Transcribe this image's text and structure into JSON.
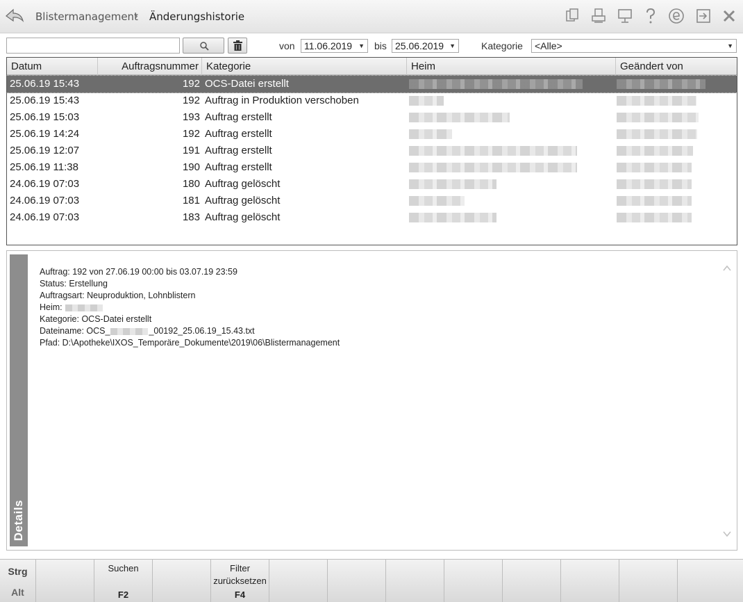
{
  "header": {
    "breadcrumb_root": "Blistermanagement",
    "breadcrumb_sep": "›",
    "breadcrumb_current": "Änderungshistorie",
    "icons": [
      "copy-icon",
      "print-icon",
      "monitor-icon",
      "help-icon",
      "e-icon",
      "exit-window-icon",
      "close-icon"
    ]
  },
  "filter": {
    "search_value": "",
    "von_label": "von",
    "von_value": "11.06.2019",
    "bis_label": "bis",
    "bis_value": "25.06.2019",
    "kategorie_label": "Kategorie",
    "kategorie_value": "<Alle>"
  },
  "table": {
    "columns": [
      "Datum",
      "Auftragsnummer",
      "Kategorie",
      "Heim",
      "Geändert von"
    ],
    "rows": [
      {
        "datum": "25.06.19 15:43",
        "nr": "192",
        "kategorie": "OCS-Datei erstellt"
      },
      {
        "datum": "25.06.19 15:43",
        "nr": "192",
        "kategorie": "Auftrag in Produktion verschoben"
      },
      {
        "datum": "25.06.19 15:03",
        "nr": "193",
        "kategorie": "Auftrag erstellt"
      },
      {
        "datum": "25.06.19 14:24",
        "nr": "192",
        "kategorie": "Auftrag erstellt"
      },
      {
        "datum": "25.06.19 12:07",
        "nr": "191",
        "kategorie": "Auftrag erstellt"
      },
      {
        "datum": "25.06.19 11:38",
        "nr": "190",
        "kategorie": "Auftrag erstellt"
      },
      {
        "datum": "24.06.19 07:03",
        "nr": "180",
        "kategorie": "Auftrag gelöscht"
      },
      {
        "datum": "24.06.19 07:03",
        "nr": "181",
        "kategorie": "Auftrag gelöscht"
      },
      {
        "datum": "24.06.19 07:03",
        "nr": "183",
        "kategorie": "Auftrag gelöscht"
      }
    ]
  },
  "details": {
    "tab_label": "Details",
    "auftrag": "Auftrag: 192 von 27.06.19 00:00 bis 03.07.19 23:59",
    "status": "Status: Erstellung",
    "auftragsart": "Auftragsart: Neuproduktion, Lohnblistern",
    "heim_label": "Heim:",
    "kategorie": "Kategorie: OCS-Datei erstellt",
    "dateiname_prefix": "Dateiname: OCS_",
    "dateiname_suffix": "_00192_25.06.19_15.43.txt",
    "pfad": "Pfad: D:\\Apotheke\\IXOS_Temporäre_Dokumente\\2019\\06\\Blistermanagement"
  },
  "footer": {
    "mod1": "Strg",
    "mod2": "Alt",
    "suchen_label": "Suchen",
    "suchen_key": "F2",
    "filter_label1": "Filter",
    "filter_label2": "zurücksetzen",
    "filter_key": "F4"
  }
}
